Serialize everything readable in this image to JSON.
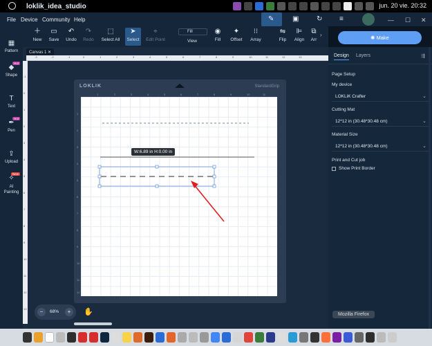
{
  "os": {
    "app_title": "loklik_idea_studio",
    "clock": "jun. 20 vie. 20:32"
  },
  "menu": {
    "items": [
      "File",
      "Device",
      "Community",
      "Help"
    ]
  },
  "toolbar": {
    "buttons": [
      {
        "id": "new",
        "label": "New",
        "icon": "plus-icon"
      },
      {
        "id": "save",
        "label": "Save",
        "icon": "save-icon"
      },
      {
        "id": "undo",
        "label": "Undo",
        "icon": "undo-icon"
      },
      {
        "id": "redo",
        "label": "Redo",
        "icon": "redo-icon"
      },
      {
        "id": "select-all",
        "label": "Select All",
        "icon": "select-all-icon"
      },
      {
        "id": "select",
        "label": "Select",
        "icon": "cursor-icon"
      },
      {
        "id": "edit-point",
        "label": "Edit Point",
        "icon": "edit-point-icon"
      },
      {
        "id": "view",
        "label": "View",
        "icon": "view-icon"
      },
      {
        "id": "fill",
        "label": "Fill",
        "icon": "fill-icon"
      },
      {
        "id": "offset",
        "label": "Offset",
        "icon": "offset-icon"
      },
      {
        "id": "array",
        "label": "Array",
        "icon": "array-icon"
      },
      {
        "id": "flip",
        "label": "Flip",
        "icon": "flip-icon"
      },
      {
        "id": "align",
        "label": "Align",
        "icon": "align-icon"
      },
      {
        "id": "arrange",
        "label": "Arr",
        "icon": "arrange-icon"
      }
    ],
    "fill_dropdown": "Fill"
  },
  "sidebar": {
    "items": [
      {
        "id": "pattern",
        "label": "Pattern",
        "icon": "pattern-icon"
      },
      {
        "id": "shape",
        "label": "Shape",
        "icon": "shape-icon",
        "badge": "Hot"
      },
      {
        "id": "text",
        "label": "Text",
        "icon": "text-icon"
      },
      {
        "id": "pen",
        "label": "Pen",
        "icon": "pen-icon",
        "badge": "Hot"
      },
      {
        "id": "upload",
        "label": "Upload",
        "icon": "upload-icon"
      },
      {
        "id": "ai",
        "label": "AI Painting",
        "icon": "ai-icon",
        "badge": "New"
      }
    ]
  },
  "canvas": {
    "tab_label": "Canvas 1",
    "mat_brand": "LOKLIK",
    "mat_type": "StandardGrip",
    "dimension_tooltip": "W:6.89 in  H:0.00 in",
    "zoom": "68%",
    "ruler_h": [
      "-3",
      "-2",
      "-1",
      "0",
      "1",
      "2",
      "3",
      "4",
      "5",
      "6",
      "7",
      "8",
      "9",
      "10",
      "11",
      "12",
      "13"
    ],
    "ruler_v": [
      "-1",
      "0",
      "1",
      "2",
      "3",
      "4",
      "5",
      "6",
      "7",
      "8",
      "9",
      "10",
      "11",
      "12",
      "13"
    ],
    "grid_cols": [
      "1",
      "2",
      "3",
      "4",
      "5",
      "6",
      "7",
      "8",
      "9",
      "10",
      "11"
    ],
    "grid_rows": [
      "1",
      "2",
      "3",
      "4",
      "5",
      "6",
      "7",
      "8",
      "9",
      "10",
      "11",
      "12"
    ]
  },
  "right_panel": {
    "make_button": "Make",
    "tabs": [
      "Design",
      "Layers"
    ],
    "section_title": "Page Setup",
    "my_device_label": "My device",
    "device_value": "LOKLiK Crafter",
    "cutting_mat_label": "Cutting Mat",
    "cutting_mat_value": "12*12 in (30.48*30.48 cm)",
    "material_size_label": "Material Size",
    "material_size_value": "12*12 in (30.48*30.48 cm)",
    "print_cut_label": "Print and Cut job",
    "show_print_border": "Show Print Border"
  },
  "taskbar": {
    "tooltip": "Mozilla Firefox"
  },
  "colors": {
    "accent": "#5f9ef5",
    "panel": "#14273b",
    "annotation_arrow": "#e02020"
  }
}
